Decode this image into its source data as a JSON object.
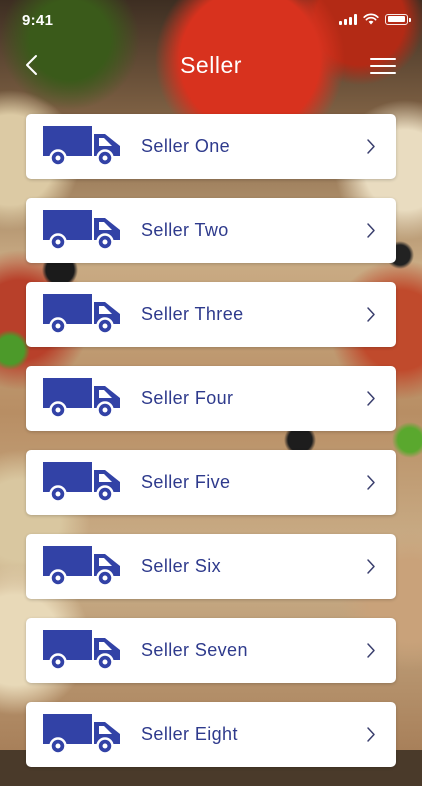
{
  "status_bar": {
    "time": "9:41"
  },
  "header": {
    "title": "Seller"
  },
  "sellers": [
    {
      "label": "Seller One"
    },
    {
      "label": "Seller Two"
    },
    {
      "label": "Seller Three"
    },
    {
      "label": "Seller Four"
    },
    {
      "label": "Seller Five"
    },
    {
      "label": "Seller Six"
    },
    {
      "label": "Seller Seven"
    },
    {
      "label": "Seller Eight"
    }
  ],
  "colors": {
    "accent": "#2e3a8c",
    "truck": "#3242a6",
    "card": "#ffffff",
    "header_text": "#ffffff"
  },
  "icons": {
    "row_icon": "truck-icon",
    "row_chevron": "chevron-right-icon",
    "back": "chevron-left-icon",
    "menu": "hamburger-menu-icon"
  }
}
